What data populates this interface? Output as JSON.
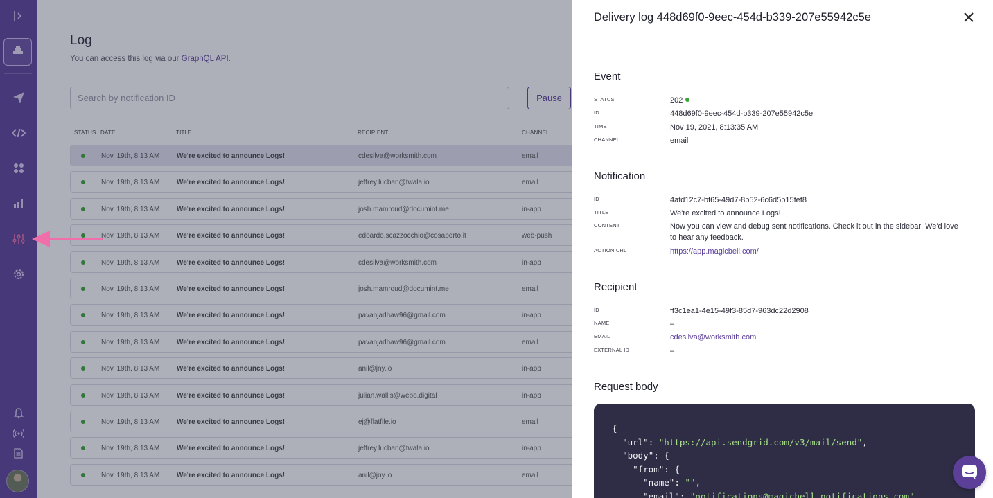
{
  "sidebar": {
    "icons": [
      "expand-sidebar-icon",
      "project-icon",
      "send-icon",
      "code-icon",
      "apps-icon",
      "analytics-icon",
      "logs-icon",
      "settings-icon",
      "bell-icon",
      "broadcast-icon",
      "docs-icon",
      "avatar"
    ],
    "active": "logs-icon"
  },
  "page": {
    "title": "Log",
    "subtitle_prefix": "You can access this log via our",
    "subtitle_link": "GraphQL API",
    "subtitle_suffix": "."
  },
  "search": {
    "placeholder": "Search by notification ID"
  },
  "pause_label": "Pause",
  "table": {
    "columns": [
      "STATUS",
      "DATE",
      "TITLE",
      "RECIPIENT",
      "CHANNEL"
    ],
    "rows": [
      {
        "date": "Nov, 19th, 8:13 AM",
        "title": "We're excited to announce Logs!",
        "recipient": "cdesilva@worksmith.com",
        "channel": "email"
      },
      {
        "date": "Nov, 19th, 8:13 AM",
        "title": "We're excited to announce Logs!",
        "recipient": "jeffrey.lucban@twala.io",
        "channel": "email"
      },
      {
        "date": "Nov, 19th, 8:13 AM",
        "title": "We're excited to announce Logs!",
        "recipient": "josh.mamroud@documint.me",
        "channel": "in-app"
      },
      {
        "date": "Nov, 19th, 8:13 AM",
        "title": "We're excited to announce Logs!",
        "recipient": "edoardo.scazzocchio@cosaporto.it",
        "channel": "web-push"
      },
      {
        "date": "Nov, 19th, 8:13 AM",
        "title": "We're excited to announce Logs!",
        "recipient": "cdesilva@worksmith.com",
        "channel": "in-app"
      },
      {
        "date": "Nov, 19th, 8:13 AM",
        "title": "We're excited to announce Logs!",
        "recipient": "josh.mamroud@documint.me",
        "channel": "email"
      },
      {
        "date": "Nov, 19th, 8:13 AM",
        "title": "We're excited to announce Logs!",
        "recipient": "pavanjadhaw96@gmail.com",
        "channel": "in-app"
      },
      {
        "date": "Nov, 19th, 8:13 AM",
        "title": "We're excited to announce Logs!",
        "recipient": "pavanjadhaw96@gmail.com",
        "channel": "email"
      },
      {
        "date": "Nov, 19th, 8:13 AM",
        "title": "We're excited to announce Logs!",
        "recipient": "anil@jny.io",
        "channel": "in-app"
      },
      {
        "date": "Nov, 19th, 8:13 AM",
        "title": "We're excited to announce Logs!",
        "recipient": "julian.wallis@webo.digital",
        "channel": "in-app"
      },
      {
        "date": "Nov, 19th, 8:13 AM",
        "title": "We're excited to announce Logs!",
        "recipient": "ej@flatfile.io",
        "channel": "email"
      },
      {
        "date": "Nov, 19th, 8:13 AM",
        "title": "We're excited to announce Logs!",
        "recipient": "jeffrey.lucban@twala.io",
        "channel": "in-app"
      },
      {
        "date": "Nov, 19th, 8:13 AM",
        "title": "We're excited to announce Logs!",
        "recipient": "anil@jny.io",
        "channel": "email"
      }
    ]
  },
  "drawer": {
    "title": "Delivery log 448d69f0-9eec-454d-b339-207e55942c5e",
    "event": {
      "heading": "Event",
      "status_label": "STATUS",
      "status": "202",
      "id_label": "ID",
      "id": "448d69f0-9eec-454d-b339-207e55942c5e",
      "time_label": "TIME",
      "time": "Nov 19, 2021, 8:13:35 AM",
      "channel_label": "CHANNEL",
      "channel": "email"
    },
    "notification": {
      "heading": "Notification",
      "id_label": "ID",
      "id": "4afd12c7-bf65-49d7-8b52-6c6d5b15fef8",
      "title_label": "TITLE",
      "title": "We're excited to announce Logs!",
      "content_label": "CONTENT",
      "content_line1": "Now you can view and debug sent notifications. Check it out in the sidebar! We'd love",
      "content_line2": "to hear any feedback.",
      "action_url_label": "ACTION URL",
      "action_url": "https://app.magicbell.com/"
    },
    "recipient": {
      "heading": "Recipient",
      "id_label": "ID",
      "id": "ff3c1ea1-4e15-49f3-85d7-963dc22d2908",
      "name_label": "NAME",
      "name": "–",
      "email_label": "EMAIL",
      "email": "cdesilva@worksmith.com",
      "external_id_label": "EXTERNAL ID",
      "external_id": "–"
    },
    "request_body": {
      "heading": "Request body",
      "lines": [
        {
          "indent": "",
          "key": "",
          "sep": "{",
          "value": "",
          "tail": ""
        },
        {
          "indent": "  ",
          "key": "\"url\"",
          "sep": ": ",
          "value": "\"https://api.sendgrid.com/v3/mail/send\"",
          "tail": ","
        },
        {
          "indent": "  ",
          "key": "\"body\"",
          "sep": ": {",
          "value": "",
          "tail": ""
        },
        {
          "indent": "    ",
          "key": "\"from\"",
          "sep": ": {",
          "value": "",
          "tail": ""
        },
        {
          "indent": "      ",
          "key": "\"name\"",
          "sep": ": ",
          "value": "\"\"",
          "tail": ","
        },
        {
          "indent": "      ",
          "key": "\"email\"",
          "sep": ": ",
          "value": "\"notifications@magicbell-notifications.com\"",
          "tail": ""
        }
      ]
    }
  },
  "colors": {
    "brand": "#5b3f98",
    "status_ok": "#3aa534",
    "code_bg": "#2e2d45",
    "code_string": "#a7e08a",
    "arrow": "#f06ea9"
  }
}
